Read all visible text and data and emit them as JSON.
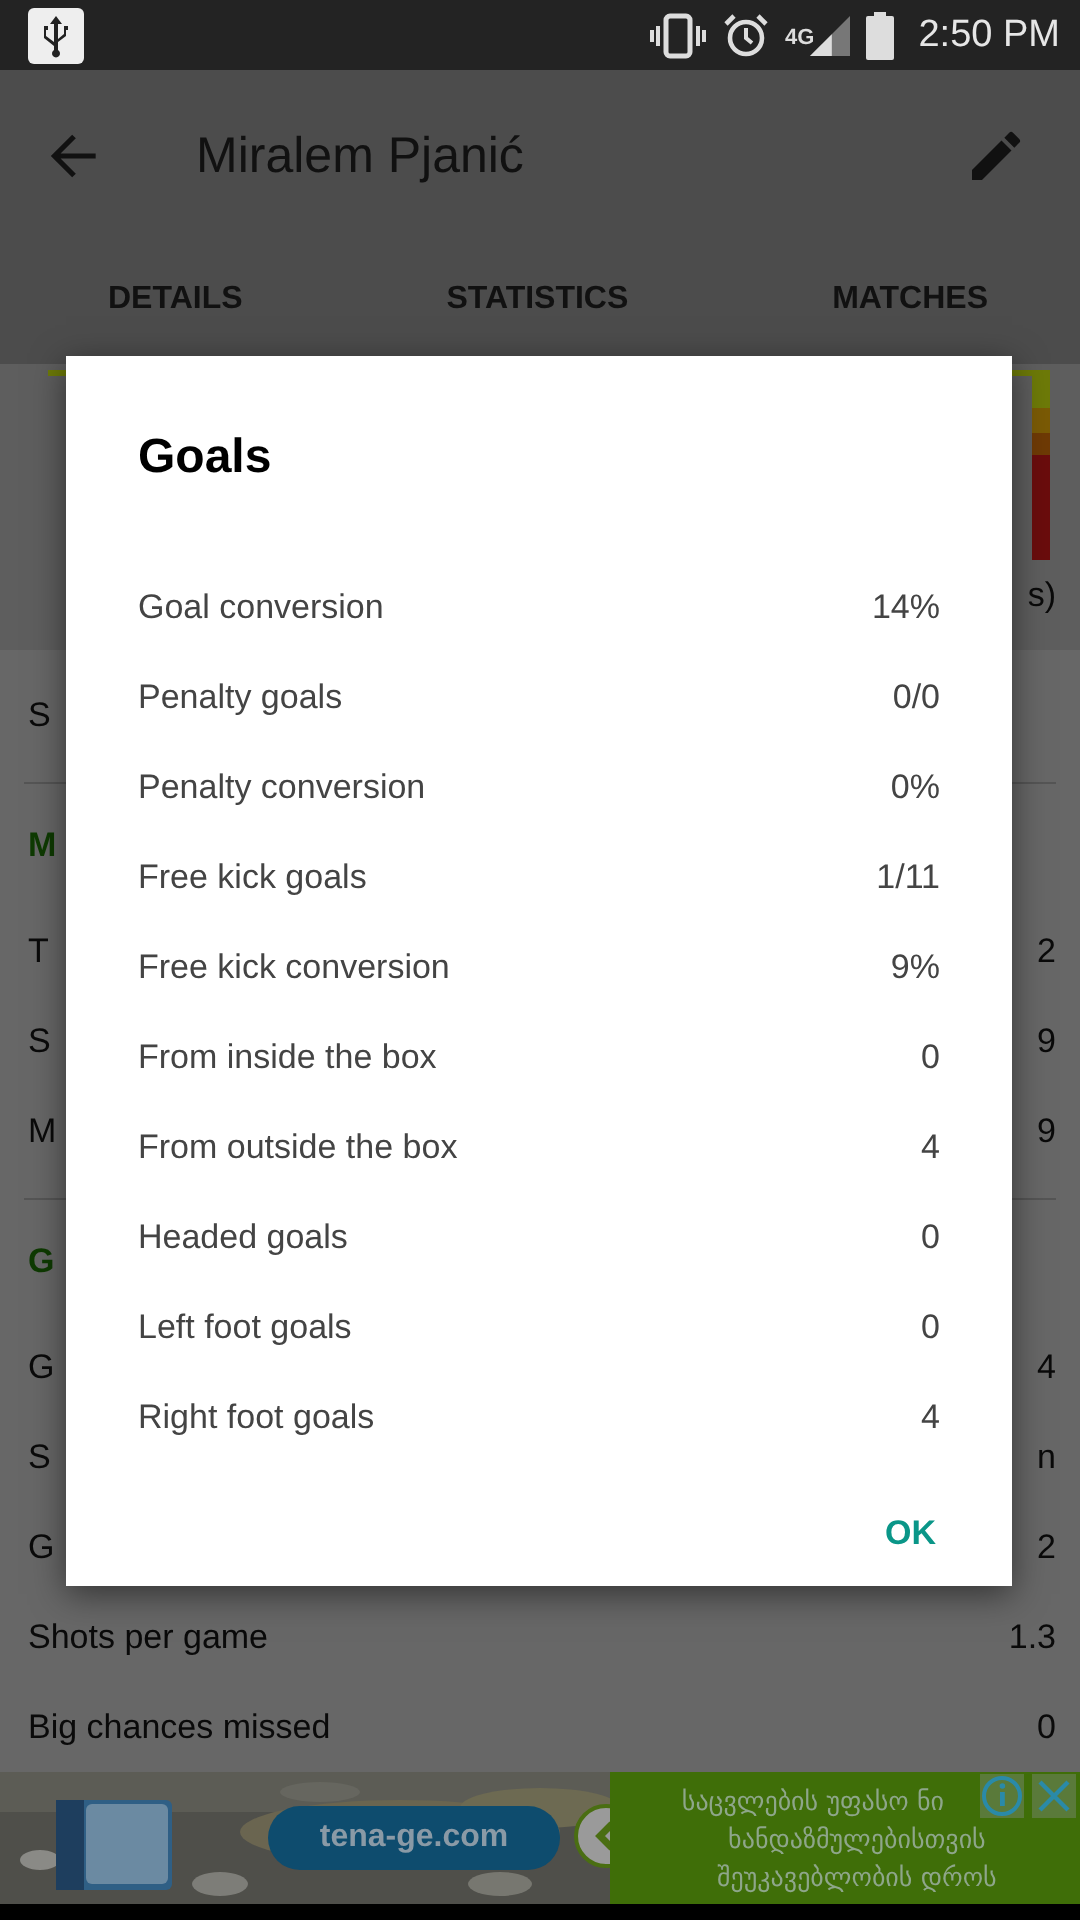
{
  "status_bar": {
    "network": "4G",
    "time": "2:50 PM"
  },
  "app_bar": {
    "title": "Miralem Pjanić",
    "tabs": [
      "DETAILS",
      "STATISTICS",
      "MATCHES"
    ]
  },
  "background": {
    "chart_note": "s)",
    "rows": [
      {
        "kind": "row",
        "label": "S",
        "value": ""
      },
      {
        "kind": "section",
        "label": "M",
        "value": ""
      },
      {
        "kind": "row",
        "label": "T",
        "value": "2"
      },
      {
        "kind": "row",
        "label": "S",
        "value": "9"
      },
      {
        "kind": "row",
        "label": "M",
        "value": "9"
      },
      {
        "kind": "section",
        "label": "G",
        "value": ""
      },
      {
        "kind": "row",
        "label": "G",
        "value": "4"
      },
      {
        "kind": "row",
        "label": "S",
        "value": "n"
      },
      {
        "kind": "row",
        "label": "G",
        "value": "2"
      },
      {
        "kind": "row",
        "label": "Shots per game",
        "value": "1.3"
      },
      {
        "kind": "row",
        "label": "Big chances missed",
        "value": "0"
      }
    ]
  },
  "dialog": {
    "title": "Goals",
    "stats": [
      {
        "label": "Goal conversion",
        "value": "14%"
      },
      {
        "label": "Penalty goals",
        "value": "0/0"
      },
      {
        "label": "Penalty conversion",
        "value": "0%"
      },
      {
        "label": "Free kick goals",
        "value": "1/11"
      },
      {
        "label": "Free kick conversion",
        "value": "9%"
      },
      {
        "label": "From inside the box",
        "value": "0"
      },
      {
        "label": "From outside the box",
        "value": "4"
      },
      {
        "label": "Headed goals",
        "value": "0"
      },
      {
        "label": "Left foot goals",
        "value": "0"
      },
      {
        "label": "Right foot goals",
        "value": "4"
      }
    ],
    "button": "OK"
  },
  "ad": {
    "link": "tena-ge.com",
    "lines": [
      "საცვლების უფასო ნი",
      "ხანდაზმულებისთვის",
      "შეუკავებლობის დროს"
    ]
  }
}
